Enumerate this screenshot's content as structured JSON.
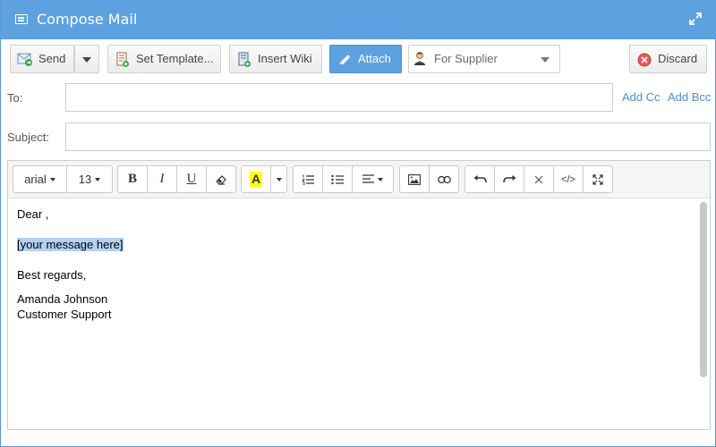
{
  "window": {
    "title": "Compose Mail"
  },
  "toolbar": {
    "send_label": "Send",
    "template_label": "Set Template...",
    "wiki_label": "Insert Wiki",
    "attach_label": "Attach",
    "supplier_value": "For Supplier",
    "discard_label": "Discard"
  },
  "fields": {
    "to_label": "To:",
    "to_value": "",
    "subject_label": "Subject:",
    "subject_value": "",
    "add_cc": "Add Cc",
    "add_bcc": "Add Bcc"
  },
  "editor": {
    "font_family": "arial",
    "font_size": "13",
    "bold": "B",
    "italic": "I",
    "underline": "U",
    "color_letter": "A",
    "code": "</>",
    "body": {
      "greeting": "Dear ,",
      "placeholder": "[your message here]",
      "closing": "Best regards,",
      "name": "Amanda Johnson",
      "team": "Customer Support"
    }
  },
  "colors": {
    "accent": "#5ea1e0",
    "link": "#4a90d9",
    "highlight": "#b4d0f4",
    "font_color_swatch": "#ffff00"
  },
  "icons": [
    "compose-icon",
    "expand-icon",
    "send-icon",
    "template-icon",
    "wiki-icon",
    "paperclip-icon",
    "supplier-person-icon",
    "discard-icon"
  ]
}
